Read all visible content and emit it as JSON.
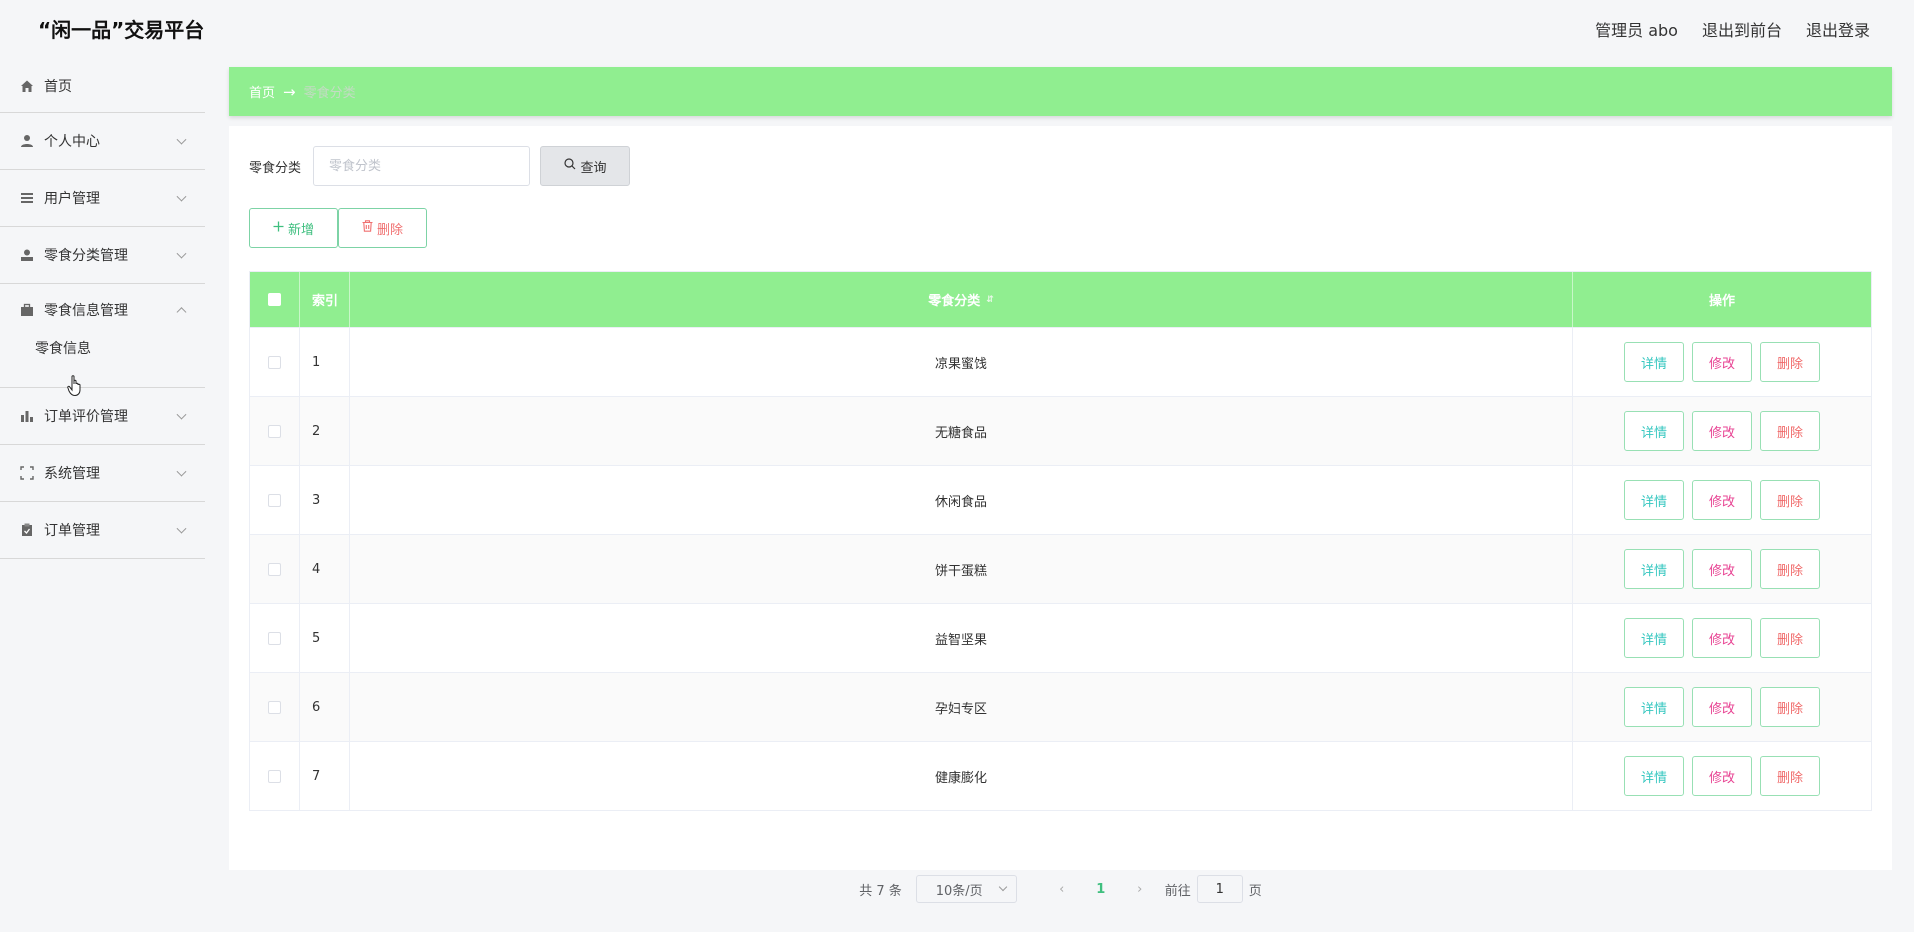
{
  "header": {
    "title": "“闲一品”交易平台",
    "admin_label": "管理员 abo",
    "to_front": "退出到前台",
    "logout": "退出登录"
  },
  "sidebar": {
    "items": [
      {
        "label": "首页",
        "icon": "home-icon"
      },
      {
        "label": "个人中心",
        "icon": "user-icon"
      },
      {
        "label": "用户管理",
        "icon": "list-icon"
      },
      {
        "label": "零食分类管理",
        "icon": "person-card-icon"
      },
      {
        "label": "零食信息管理",
        "icon": "briefcase-icon",
        "expanded": true,
        "children": [
          "零食信息"
        ]
      },
      {
        "label": "订单评价管理",
        "icon": "bar-chart-icon"
      },
      {
        "label": "系统管理",
        "icon": "frame-icon"
      },
      {
        "label": "订单管理",
        "icon": "clipboard-icon"
      }
    ]
  },
  "breadcrumb": {
    "home": "首页",
    "arrow": "→",
    "current": "零食分类"
  },
  "search": {
    "label": "零食分类",
    "placeholder": "零食分类",
    "button": "查询"
  },
  "actions": {
    "add": "新增",
    "delete": "删除"
  },
  "table": {
    "headers": {
      "index": "索引",
      "category": "零食分类",
      "ops": "操作"
    },
    "rows": [
      {
        "index": "1",
        "category": "凉果蜜饯"
      },
      {
        "index": "2",
        "category": "无糖食品"
      },
      {
        "index": "3",
        "category": "休闲食品"
      },
      {
        "index": "4",
        "category": "饼干蛋糕"
      },
      {
        "index": "5",
        "category": "益智坚果"
      },
      {
        "index": "6",
        "category": "孕妇专区"
      },
      {
        "index": "7",
        "category": "健康膨化"
      }
    ],
    "op_labels": {
      "detail": "详情",
      "edit": "修改",
      "delete": "删除"
    }
  },
  "pagination": {
    "total": "共 7 条",
    "page_size": "10条/页",
    "current_page": "1",
    "goto_prefix": "前往",
    "goto_value": "1",
    "goto_suffix": "页"
  },
  "colors": {
    "accent": "#90ee90",
    "primary_text": "#3fbf7f",
    "danger": "#f06a6a"
  }
}
